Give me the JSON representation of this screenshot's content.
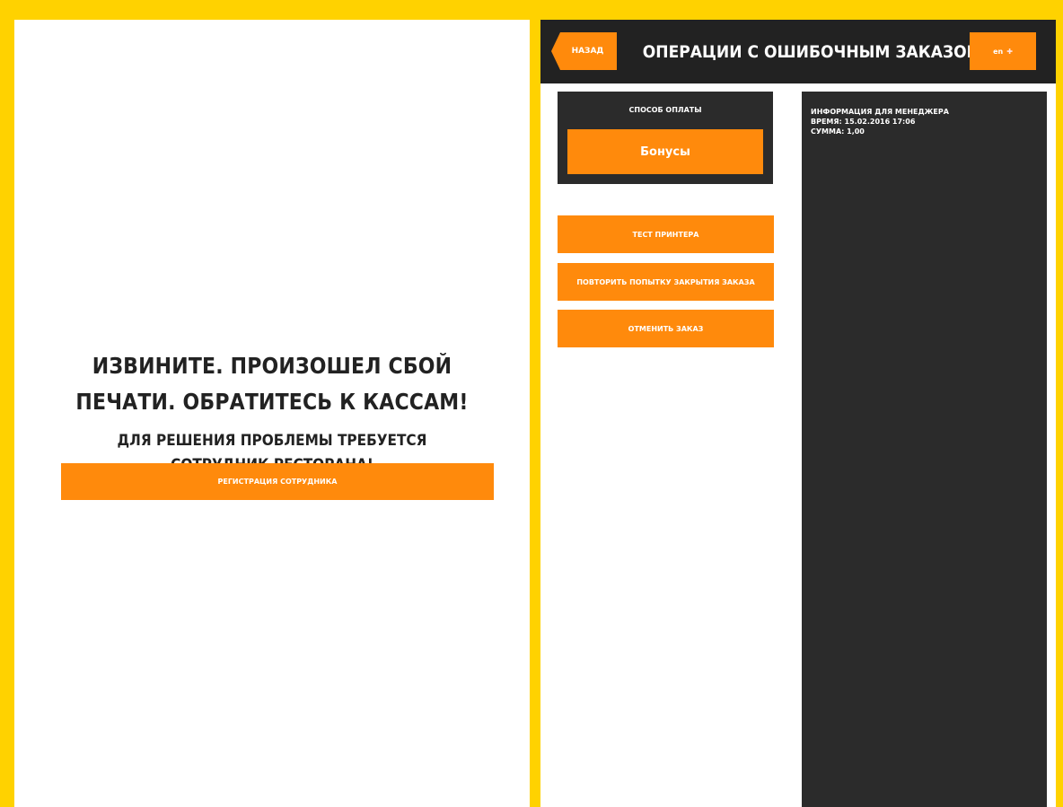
{
  "left": {
    "title_line1": "ИЗВИНИТЕ. ПРОИЗОШЕЛ СБОЙ",
    "title_line2": "ПЕЧАТИ. ОБРАТИТЕСЬ К КАССАМ!",
    "subtitle_line1": "ДЛЯ РЕШЕНИЯ ПРОБЛЕМЫ ТРЕБУЕТСЯ",
    "subtitle_line2": "СОТРУДНИК РЕСТОРАНА!",
    "register_button": "РЕГИСТРАЦИЯ СОТРУДНИКА"
  },
  "header": {
    "back_label": "НАЗАД",
    "title": "ОПЕРАЦИИ С ОШИБОЧНЫМ ЗАКАЗОМ",
    "lang_label": "en",
    "lang_flag_icon": "uk-flag-icon"
  },
  "payment": {
    "label": "СПОСОБ ОПЛАТЫ",
    "method": "Бонусы"
  },
  "actions": [
    {
      "label": "ТЕСТ ПРИНТЕРА"
    },
    {
      "label": "ПОВТОРИТЬ ПОПЫТКУ ЗАКРЫТИЯ ЗАКАЗА"
    },
    {
      "label": "ОТМЕНИТЬ ЗАКАЗ"
    }
  ],
  "info": {
    "heading": "ИНФОРМАЦИЯ ДЛЯ МЕНЕДЖЕРА",
    "time": "ВРЕМЯ: 15.02.2016 17:06",
    "sum": "СУММА: 1,00"
  },
  "colors": {
    "frame": "#ffd200",
    "accent": "#ff8a0c",
    "dark": "#222222",
    "panel": "#2b2b2b"
  }
}
